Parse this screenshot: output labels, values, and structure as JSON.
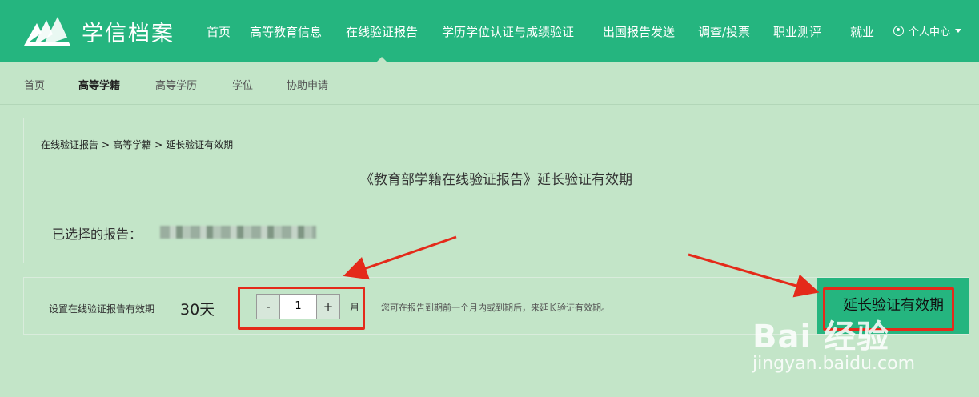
{
  "header": {
    "logo_text": "学信档案",
    "nav": [
      {
        "label": "首页"
      },
      {
        "label": "高等教育信息"
      },
      {
        "label": "在线验证报告"
      },
      {
        "label": "学历学位认证与成绩验证"
      },
      {
        "label": "出国报告发送"
      },
      {
        "label": "调查/投票"
      },
      {
        "label": "职业测评"
      },
      {
        "label": "就业"
      }
    ],
    "active_nav": "在线验证报告",
    "user_center": "个人中心"
  },
  "subnav": {
    "items": [
      {
        "label": "首页"
      },
      {
        "label": "高等学籍"
      },
      {
        "label": "高等学历"
      },
      {
        "label": "学位"
      },
      {
        "label": "协助申请"
      }
    ],
    "active": "高等学籍"
  },
  "breadcrumb": {
    "items": [
      "在线验证报告",
      "高等学籍",
      "延长验证有效期"
    ],
    "separator": ">"
  },
  "page_title": "《教育部学籍在线验证报告》延长验证有效期",
  "selected_report_label": "已选择的报告：",
  "extend": {
    "set_label": "设置在线验证报告有效期",
    "days": "30天",
    "minus": "-",
    "value": "1",
    "plus": "+",
    "unit": "月",
    "hint": "您可在报告到期前一个月内或到期后，来延长验证有效期。",
    "button": "延长验证有效期"
  },
  "watermark": {
    "main": "Bai 经验",
    "sub": "jingyan.baidu.com"
  },
  "colors": {
    "brand_green": "#25b57f",
    "background": "#c3e5c8",
    "annotation_red": "#e42a1a"
  }
}
